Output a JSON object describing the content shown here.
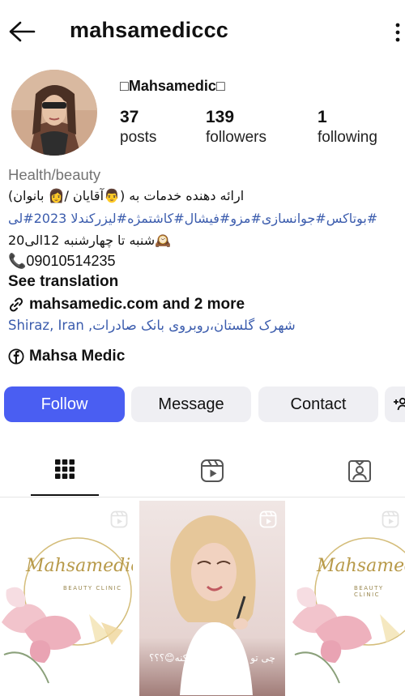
{
  "header": {
    "username": "mahsamediccc"
  },
  "profile": {
    "display_name": "□Mahsamedic□",
    "stats": [
      {
        "value": "37",
        "label": "posts"
      },
      {
        "value": "139",
        "label": "followers"
      },
      {
        "value": "1",
        "label": "following"
      }
    ],
    "category": "Health/beauty",
    "bio_line1": "ارائه دهنده خدمات به (👨آقایان /👩 بانوان)",
    "bio_hashtags": "#بوتاکس#جوانسازی#مزو#فیشال#کاشتمژه#لیزرکندلا 2023#لی",
    "bio_hours": "🕰️شنبه تا چهارشنبه 12الی20",
    "bio_phone": "📞09010514235",
    "see_translation": "See translation",
    "link_text": "mahsamedic.com and 2 more",
    "location": "شهرک گلستان،روبروی بانک صادرات, Shiraz, Iran",
    "facebook_name": "Mahsa Medic"
  },
  "actions": {
    "follow": "Follow",
    "message": "Message",
    "contact": "Contact",
    "add_person": "+👤"
  },
  "tabs": [
    {
      "name": "grid",
      "icon": "grid-icon"
    },
    {
      "name": "reels",
      "icon": "reels-icon"
    },
    {
      "name": "tagged",
      "icon": "tagged-icon"
    }
  ],
  "posts": [
    {
      "type": "reel",
      "logo": "Mahsamediccc",
      "logo_sub": "BEAUTY CLINIC"
    },
    {
      "type": "reel",
      "caption": "چی تو رو خوشحال میکنه😊؟؟؟"
    },
    {
      "type": "reel",
      "logo": "Mahsamediccc",
      "logo_sub": "BEAUTY CLINIC"
    }
  ],
  "colors": {
    "accent": "#4a5ef2",
    "link": "#3b5cad",
    "secondary_button": "#efeff3",
    "muted_text": "#737373"
  }
}
